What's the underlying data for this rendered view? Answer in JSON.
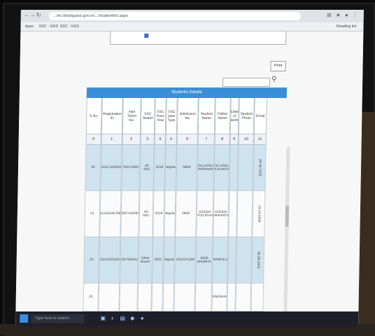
{
  "browser": {
    "address": "...nic.telangana.gov.in/.../studentlist.aspx",
    "bookmarks": [
      "Apps",
      "SSC - NSS",
      "SSC - NSS"
    ],
    "reading_list": "Reading list"
  },
  "page": {
    "print_label": "Print",
    "table_title": "Students Details",
    "headers": [
      "S.No.",
      "Registration ID",
      "Hall Ticket No.",
      "SSC Board",
      "SSC Pass Year",
      "SSC pass Type",
      "Admission No.",
      "Student Name",
      "Father Name",
      "Date of Birth",
      "Student Photo",
      "Email"
    ],
    "column_index": [
      "0",
      "1",
      "2",
      "3",
      "4",
      "5",
      "6",
      "7",
      "8",
      "9",
      "10",
      "11"
    ],
    "rows": [
      {
        "sno": "20",
        "reg": "2112171045027",
        "hall": "T42170407",
        "board": "AP SSC",
        "year": "2019",
        "type": "Regular",
        "adm": "NEW",
        "name": "GOLLAPALLY VAISHNAVI",
        "father": "GOLLAPALLY RAJA MOULI",
        "dob": "",
        "photo": "",
        "email": "26-06-2003"
      },
      {
        "sno": "21",
        "reg": "2112151457684",
        "hall": "1927119291",
        "board": "AP SSC",
        "year": "2019",
        "type": "Regular",
        "adm": "NEW",
        "name": "GOUDA POOJITHA",
        "father": "GOUDA SRIKANTH",
        "dob": "",
        "photo": "",
        "email": "10-10-2004"
      },
      {
        "sno": "22",
        "reg": "2111212232211",
        "hall": "1927910411",
        "board": "Other Board",
        "year": "2021",
        "type": "Regular",
        "adm": "1912121196",
        "name": "JADA SHOBHA",
        "father": "RAMULU",
        "dob": "",
        "photo": "",
        "email": "06-06-2003"
      },
      {
        "sno": "23",
        "reg": "",
        "hall": "",
        "board": "",
        "year": "",
        "type": "",
        "adm": "",
        "name": "",
        "father": "ANDDHA",
        "dob": "",
        "photo": "",
        "email": ""
      }
    ]
  },
  "taskbar": {
    "search_placeholder": "Type here to search"
  }
}
